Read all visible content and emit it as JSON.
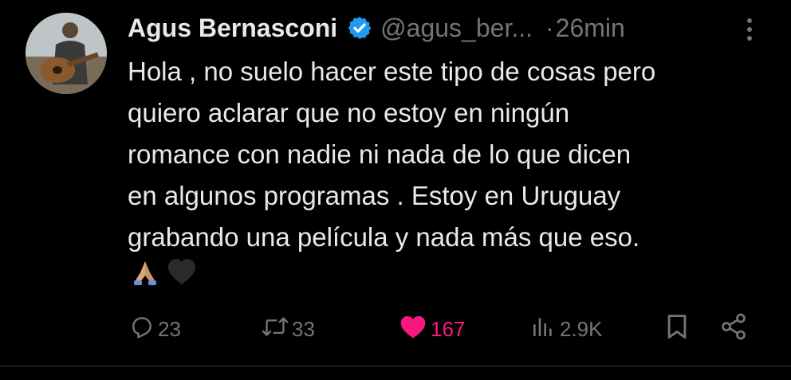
{
  "tweet": {
    "author_name": "Agus Bernasconi",
    "handle": "@agus_ber...",
    "separator": "·",
    "time": "26min",
    "text": "Hola , no suelo hacer este tipo de cosas pero\nquiero aclarar que no estoy en ningún\nromance con nadie ni nada de lo que dicen\nen algunos programas . Estoy en Uruguay\ngrabando una película y nada más que eso.",
    "emojis": [
      "🙏",
      "🖤"
    ]
  },
  "actions": {
    "replies": "23",
    "reposts": "33",
    "likes": "167",
    "views": "2.9K"
  },
  "icons": {
    "verified": "verified-badge-icon",
    "more": "more-vertical-icon",
    "reply": "reply-icon",
    "repost": "repost-icon",
    "like": "heart-icon",
    "views": "views-chart-icon",
    "bookmark": "bookmark-icon",
    "share": "share-icon"
  },
  "colors": {
    "background": "#000000",
    "text": "#e7e9ea",
    "muted": "#71767b",
    "verified": "#1d9bf0",
    "like": "#f91880"
  }
}
